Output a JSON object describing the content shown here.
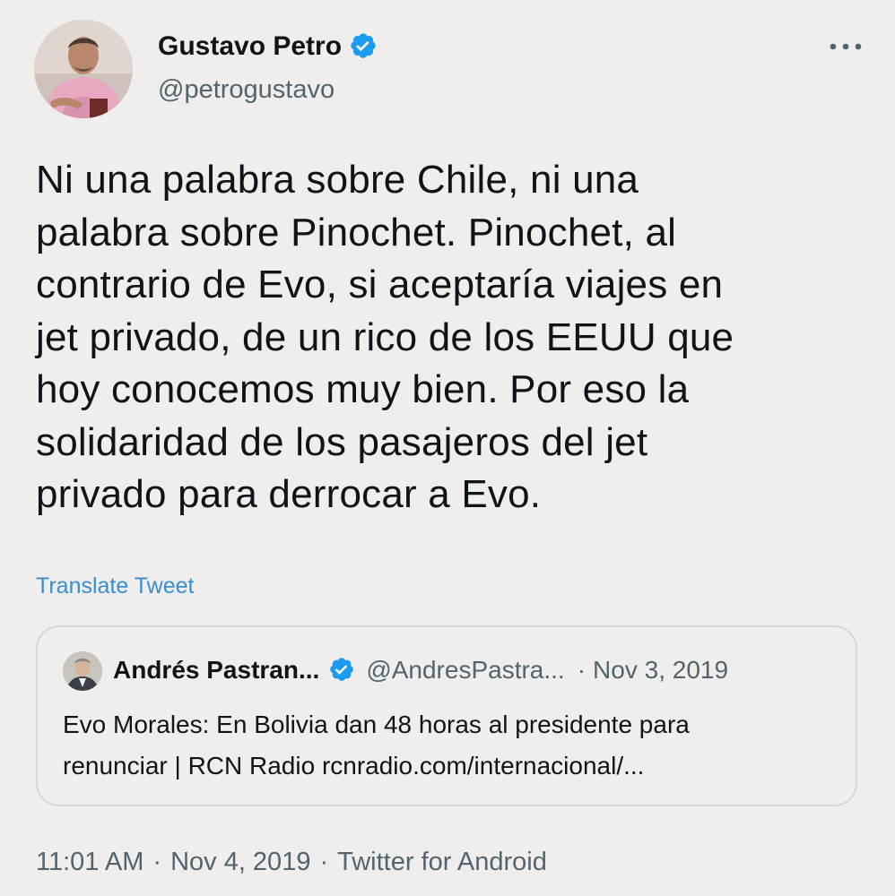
{
  "author": {
    "name": "Gustavo Petro",
    "handle": "@petrogustavo",
    "verified": true
  },
  "tweet": {
    "text_lines": [
      "Ni una palabra sobre Chile, ni una",
      "palabra sobre Pinochet. Pinochet, al",
      "contrario de Evo, si aceptaría viajes en",
      "jet privado, de un rico de los EEUU que",
      "hoy conocemos muy bien. Por eso la",
      "solidaridad de los pasajeros del jet",
      "privado para derrocar a Evo."
    ],
    "translate_label": "Translate Tweet"
  },
  "quoted_tweet": {
    "author": "Andrés Pastran...",
    "handle": "@AndresPastra...",
    "separator": "·",
    "date": "Nov 3, 2019",
    "verified": true,
    "text_lines": [
      "Evo Morales: En Bolivia dan 48 horas al presidente para",
      "renunciar | RCN Radio rcnradio.com/internacional/..."
    ]
  },
  "meta": {
    "time": "11:01 AM",
    "date": "Nov 4, 2019",
    "source": "Twitter for Android",
    "separator": "·"
  },
  "icons": {
    "verified": "verified-badge-icon",
    "more": "more-horizontal-icon"
  },
  "colors": {
    "background": "#efeeec",
    "verified_blue": "#1d9bf0",
    "link_blue": "#3a8fd0",
    "secondary_text": "#536471"
  }
}
